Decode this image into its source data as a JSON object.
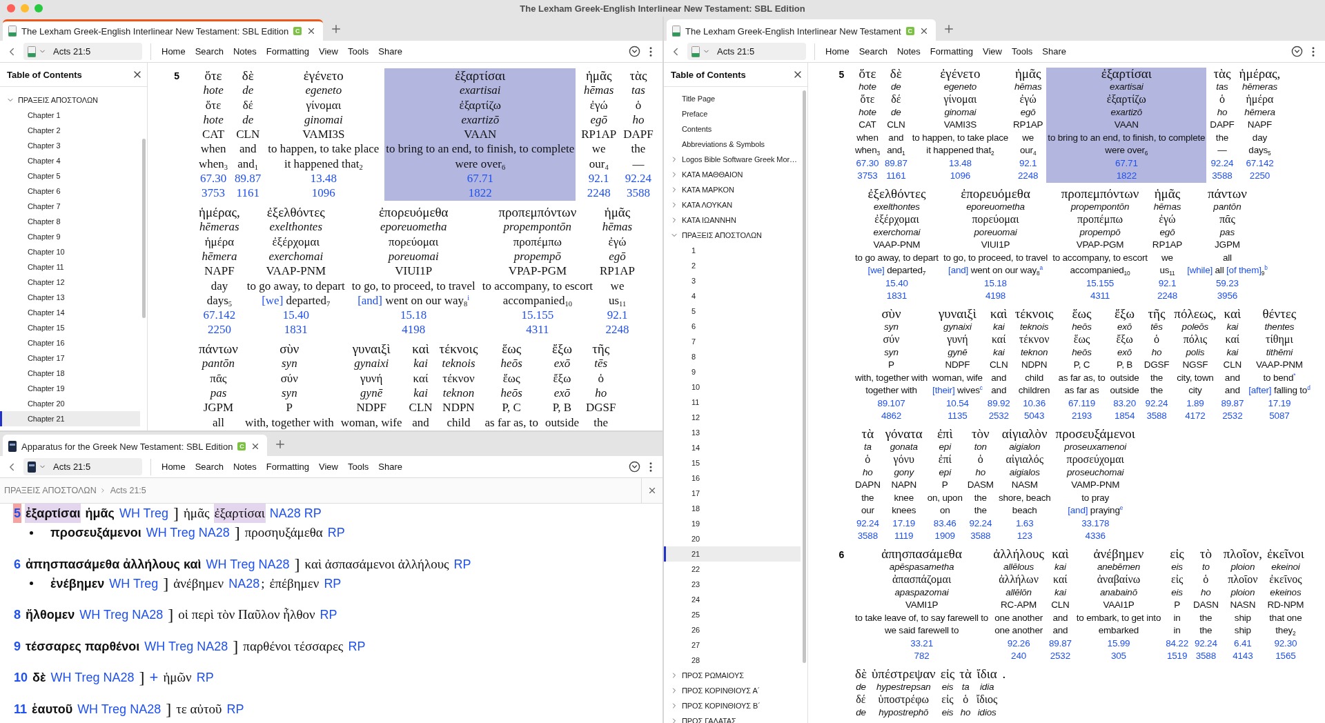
{
  "window": {
    "title": "The Lexham Greek-English Interlinear New Testament: SBL Edition"
  },
  "left_pane": {
    "tab": {
      "title": "The Lexham Greek-English Interlinear New Testament: SBL Edition",
      "badge": "C",
      "focused": true
    },
    "toolbar": {
      "reference": "Acts 21:5",
      "menu": [
        "Home",
        "Search",
        "Notes",
        "Formatting",
        "View",
        "Tools",
        "Share"
      ]
    },
    "toc": {
      "title": "Table of Contents",
      "items": [
        {
          "label": "ΠΡΑΞΕΙΣ ΑΠΟΣΤΟΛΩΝ",
          "expanded": true,
          "selected": false,
          "children": [
            {
              "label": "Chapter 1",
              "selected": false
            },
            {
              "label": "Chapter 2",
              "selected": false
            },
            {
              "label": "Chapter 3",
              "selected": false
            },
            {
              "label": "Chapter 4",
              "selected": false
            },
            {
              "label": "Chapter 5",
              "selected": false
            },
            {
              "label": "Chapter 6",
              "selected": false
            },
            {
              "label": "Chapter 7",
              "selected": false
            },
            {
              "label": "Chapter 8",
              "selected": false
            },
            {
              "label": "Chapter 9",
              "selected": false
            },
            {
              "label": "Chapter 10",
              "selected": false
            },
            {
              "label": "Chapter 11",
              "selected": false
            },
            {
              "label": "Chapter 12",
              "selected": false
            },
            {
              "label": "Chapter 13",
              "selected": false
            },
            {
              "label": "Chapter 14",
              "selected": false
            },
            {
              "label": "Chapter 15",
              "selected": false
            },
            {
              "label": "Chapter 16",
              "selected": false
            },
            {
              "label": "Chapter 17",
              "selected": false
            },
            {
              "label": "Chapter 18",
              "selected": false
            },
            {
              "label": "Chapter 19",
              "selected": false
            },
            {
              "label": "Chapter 20",
              "selected": false
            },
            {
              "label": "Chapter 21",
              "selected": true
            }
          ]
        }
      ]
    },
    "interlinear": {
      "verses": [
        {
          "number": "5",
          "rows": [
            {
              "words": [
                {
                  "greek": "ὅτε",
                  "translit": "hote",
                  "lemma": "ὅτε",
                  "lemma_translit": "hote",
                  "morph": "CAT",
                  "gloss": "when",
                  "translation": "when$_{3}$",
                  "louw_nida": "67.30",
                  "gk": "3753",
                  "selected": false
                },
                {
                  "greek": "δὲ",
                  "translit": "de",
                  "lemma": "δέ",
                  "lemma_translit": "de",
                  "morph": "CLN",
                  "gloss": "and",
                  "translation": "and$_{1}$",
                  "louw_nida": "89.87",
                  "gk": "1161",
                  "selected": false
                },
                {
                  "greek": "ἐγένετο",
                  "translit": "egeneto",
                  "lemma": "γίνομαι",
                  "lemma_translit": "ginomai",
                  "morph": "VAMI3S",
                  "gloss": "to happen, to take place",
                  "translation": "it happened that$_{2}$",
                  "louw_nida": "13.48",
                  "gk": "1096",
                  "selected": false
                },
                {
                  "greek": "ἐξαρτίσαι",
                  "translit": "exartisai",
                  "lemma": "ἐξαρτίζω",
                  "lemma_translit": "exartizō",
                  "morph": "VAAN",
                  "gloss": "to bring to an end, to finish, to complete",
                  "translation": "were over$_{6}$",
                  "louw_nida": "67.71",
                  "gk": "1822",
                  "selected": true
                },
                {
                  "greek": "ἡμᾶς",
                  "translit": "hēmas",
                  "lemma": "ἐγώ",
                  "lemma_translit": "egō",
                  "morph": "RP1AP",
                  "gloss": "we",
                  "translation": "our$_{4}$",
                  "louw_nida": "92.1",
                  "gk": "2248",
                  "selected": false
                },
                {
                  "greek": "τὰς",
                  "translit": "tas",
                  "lemma": "ὁ",
                  "lemma_translit": "ho",
                  "morph": "DAPF",
                  "gloss": "the",
                  "translation": "—",
                  "louw_nida": "92.24",
                  "gk": "3588",
                  "selected": false
                }
              ]
            },
            {
              "words": [
                {
                  "greek": "ἡμέρας,",
                  "translit": "hēmeras",
                  "lemma": "ἡμέρα",
                  "lemma_translit": "hēmera",
                  "morph": "NAPF",
                  "gloss": "day",
                  "translation": "days$_{5}$",
                  "louw_nida": "67.142",
                  "gk": "2250",
                  "selected": false
                },
                {
                  "greek": "ἐξελθόντες",
                  "translit": "exelthontes",
                  "lemma": "ἐξέρχομαι",
                  "lemma_translit": "exerchomai",
                  "morph": "VAAP-PNM",
                  "gloss": "to go away, to depart",
                  "translation": "[we] departed$_{7}$",
                  "louw_nida": "15.40",
                  "gk": "1831",
                  "selected": false
                },
                {
                  "greek": "ἐπορευόμεθα",
                  "translit": "eporeuometha",
                  "lemma": "πορεύομαι",
                  "lemma_translit": "poreuomai",
                  "morph": "VIUI1P",
                  "gloss": "to go, to proceed, to travel",
                  "translation": "[and] went on our way$_{8}$$^{i}$",
                  "louw_nida": "15.18",
                  "gk": "4198",
                  "selected": false
                },
                {
                  "greek": "προπεμπόντων",
                  "translit": "propempontōn",
                  "lemma": "προπέμπω",
                  "lemma_translit": "propempō",
                  "morph": "VPAP-PGM",
                  "gloss": "to accompany, to escort",
                  "translation": "accompanied$_{10}$",
                  "louw_nida": "15.155",
                  "gk": "4311",
                  "selected": false
                },
                {
                  "greek": "ἡμᾶς",
                  "translit": "hēmas",
                  "lemma": "ἐγώ",
                  "lemma_translit": "egō",
                  "morph": "RP1AP",
                  "gloss": "we",
                  "translation": "us$_{11}$",
                  "louw_nida": "92.1",
                  "gk": "2248",
                  "selected": false
                }
              ]
            },
            {
              "words": [
                {
                  "greek": "πάντων",
                  "translit": "pantōn",
                  "lemma": "πᾶς",
                  "lemma_translit": "pas",
                  "morph": "JGPM",
                  "gloss": "all",
                  "selected": false
                },
                {
                  "greek": "σὺν",
                  "translit": "syn",
                  "lemma": "σύν",
                  "lemma_translit": "syn",
                  "morph": "P",
                  "gloss": "with, together with",
                  "selected": false
                },
                {
                  "greek": "γυναιξὶ",
                  "translit": "gynaixi",
                  "lemma": "γυνή",
                  "lemma_translit": "gynē",
                  "morph": "NDPF",
                  "gloss": "woman, wife",
                  "selected": false
                },
                {
                  "greek": "καὶ",
                  "translit": "kai",
                  "lemma": "καί",
                  "lemma_translit": "kai",
                  "morph": "CLN",
                  "gloss": "and",
                  "selected": false
                },
                {
                  "greek": "τέκνοις",
                  "translit": "teknois",
                  "lemma": "τέκνον",
                  "lemma_translit": "teknon",
                  "morph": "NDPN",
                  "gloss": "child",
                  "selected": false
                },
                {
                  "greek": "ἕως",
                  "translit": "heōs",
                  "lemma": "ἕως",
                  "lemma_translit": "heōs",
                  "morph": "P, C",
                  "gloss": "as far as, to",
                  "selected": false
                },
                {
                  "greek": "ἔξω",
                  "translit": "exō",
                  "lemma": "ἔξω",
                  "lemma_translit": "exō",
                  "morph": "P, B",
                  "gloss": "outside",
                  "selected": false
                },
                {
                  "greek": "τῆς",
                  "translit": "tēs",
                  "lemma": "ὁ",
                  "lemma_translit": "ho",
                  "morph": "DGSF",
                  "gloss": "the",
                  "selected": false
                }
              ]
            }
          ]
        }
      ]
    }
  },
  "apparatus_pane": {
    "tab": {
      "title": "Apparatus for the Greek New Testament: SBL Edition",
      "badge": "C",
      "focused": false
    },
    "toolbar": {
      "reference": "Acts 21:5",
      "menu": [
        "Home",
        "Search",
        "Notes",
        "Formatting",
        "View",
        "Tools",
        "Share"
      ]
    },
    "breadcrumb": [
      "ΠΡΑΞΕΙΣ ΑΠΟΣΤΟΛΩΝ",
      "Acts 21:5"
    ],
    "entries": [
      {
        "kind": "main",
        "segments": [
          {
            "kind": "verse",
            "text": "5",
            "highlighted": true
          },
          {
            "kind": "lemma",
            "text": "ἐξαρτίσαι",
            "highlighted": true
          },
          {
            "kind": "lemma",
            "text": "ἡμᾶς",
            "highlighted": false
          },
          {
            "kind": "siglum",
            "text": "WH Treg",
            "highlighted": false
          },
          {
            "kind": "bracket",
            "text": "]",
            "highlighted": false
          },
          {
            "kind": "reading",
            "text": "ἡμᾶς",
            "highlighted": false
          },
          {
            "kind": "reading",
            "text": "ἐξαρτίσαι",
            "highlighted": true
          },
          {
            "kind": "siglum",
            "text": "NA28 RP",
            "highlighted": false
          }
        ]
      },
      {
        "kind": "sub",
        "segments": [
          {
            "kind": "lemma",
            "text": "προσευξάμενοι",
            "highlighted": false
          },
          {
            "kind": "siglum",
            "text": "WH Treg NA28",
            "highlighted": false
          },
          {
            "kind": "bracket",
            "text": "]",
            "highlighted": false
          },
          {
            "kind": "reading",
            "text": "προσηυξάμεθα",
            "highlighted": false
          },
          {
            "kind": "siglum",
            "text": "RP",
            "highlighted": false
          }
        ]
      },
      {
        "kind": "main",
        "segments": [
          {
            "kind": "verse",
            "text": "6",
            "highlighted": false
          },
          {
            "kind": "lemma",
            "text": "ἀπησπασάμεθα ἀλλήλους καὶ",
            "highlighted": false
          },
          {
            "kind": "siglum",
            "text": "WH Treg NA28",
            "highlighted": false
          },
          {
            "kind": "bracket",
            "text": "]",
            "highlighted": false
          },
          {
            "kind": "reading",
            "text": "καὶ ἀσπασάμενοι ἀλλήλους",
            "highlighted": false
          },
          {
            "kind": "siglum",
            "text": "RP",
            "highlighted": false
          }
        ]
      },
      {
        "kind": "sub",
        "segments": [
          {
            "kind": "lemma",
            "text": "ἐνέβημεν",
            "highlighted": false
          },
          {
            "kind": "siglum",
            "text": "WH Treg",
            "highlighted": false
          },
          {
            "kind": "bracket",
            "text": "]",
            "highlighted": false
          },
          {
            "kind": "reading",
            "text": "ἀνέβημεν",
            "highlighted": false
          },
          {
            "kind": "siglum",
            "text": "NA28",
            "highlighted": false
          },
          {
            "kind": "punct",
            "text": ";",
            "highlighted": false
          },
          {
            "kind": "reading",
            "text": "ἐπέβημεν",
            "highlighted": false
          },
          {
            "kind": "siglum",
            "text": "RP",
            "highlighted": false
          }
        ]
      },
      {
        "kind": "main",
        "segments": [
          {
            "kind": "verse",
            "text": "8",
            "highlighted": false
          },
          {
            "kind": "lemma",
            "text": "ἤλθομεν",
            "highlighted": false
          },
          {
            "kind": "siglum",
            "text": "WH Treg NA28",
            "highlighted": false
          },
          {
            "kind": "bracket",
            "text": "]",
            "highlighted": false
          },
          {
            "kind": "reading",
            "text": "οἱ περὶ τὸν Παῦλον ἦλθον",
            "highlighted": false
          },
          {
            "kind": "siglum",
            "text": "RP",
            "highlighted": false
          }
        ]
      },
      {
        "kind": "main",
        "segments": [
          {
            "kind": "verse",
            "text": "9",
            "highlighted": false
          },
          {
            "kind": "lemma",
            "text": "τέσσαρες παρθένοι",
            "highlighted": false
          },
          {
            "kind": "siglum",
            "text": "WH Treg NA28",
            "highlighted": false
          },
          {
            "kind": "bracket",
            "text": "]",
            "highlighted": false
          },
          {
            "kind": "reading",
            "text": "παρθένοι τέσσαρες",
            "highlighted": false
          },
          {
            "kind": "siglum",
            "text": "RP",
            "highlighted": false
          }
        ]
      },
      {
        "kind": "main",
        "segments": [
          {
            "kind": "verse",
            "text": "10",
            "highlighted": false
          },
          {
            "kind": "lemma",
            "text": "δὲ",
            "highlighted": false
          },
          {
            "kind": "siglum",
            "text": "WH Treg NA28",
            "highlighted": false
          },
          {
            "kind": "bracket",
            "text": "]",
            "highlighted": false
          },
          {
            "kind": "sign",
            "text": "+",
            "highlighted": false
          },
          {
            "kind": "reading",
            "text": "ἡμῶν",
            "highlighted": false
          },
          {
            "kind": "siglum",
            "text": "RP",
            "highlighted": false
          }
        ]
      },
      {
        "kind": "main",
        "segments": [
          {
            "kind": "verse",
            "text": "11",
            "highlighted": false
          },
          {
            "kind": "lemma",
            "text": "ἑαυτοῦ",
            "highlighted": false
          },
          {
            "kind": "siglum",
            "text": "WH Treg NA28",
            "highlighted": false
          },
          {
            "kind": "bracket",
            "text": "]",
            "highlighted": false
          },
          {
            "kind": "reading",
            "text": "τε αὐτοῦ",
            "highlighted": false
          },
          {
            "kind": "siglum",
            "text": "RP",
            "highlighted": false
          }
        ]
      }
    ]
  },
  "right_pane": {
    "tab": {
      "title": "The Lexham Greek-English Interlinear New Testament",
      "badge": "C",
      "focused": false
    },
    "toolbar": {
      "reference": "Acts 21:5",
      "menu": [
        "Home",
        "Search",
        "Notes",
        "Formatting",
        "View",
        "Tools",
        "Share"
      ]
    },
    "toc": {
      "title": "Table of Contents",
      "items": [
        {
          "label": "Title Page",
          "selected": false
        },
        {
          "label": "Preface",
          "selected": false
        },
        {
          "label": "Contents",
          "selected": false
        },
        {
          "label": "Abbreviations & Symbols",
          "selected": false
        },
        {
          "label": "Logos Bible Software Greek Mor…",
          "expanded": false,
          "selected": false
        },
        {
          "label": "ΚΑΤΑ ΜΑΘΘΑΙΟΝ",
          "expanded": false,
          "selected": false
        },
        {
          "label": "ΚΑΤΑ ΜΑΡΚΟΝ",
          "expanded": false,
          "selected": false
        },
        {
          "label": "ΚΑΤΑ ΛΟΥΚΑΝ",
          "expanded": false,
          "selected": false
        },
        {
          "label": "ΚΑΤΑ ΙΩΑΝΝΗΝ",
          "expanded": false,
          "selected": false
        },
        {
          "label": "ΠΡΑΞΕΙΣ ΑΠΟΣΤΟΛΩΝ",
          "expanded": true,
          "selected": false,
          "children": [
            {
              "label": "1",
              "selected": false
            },
            {
              "label": "2",
              "selected": false
            },
            {
              "label": "3",
              "selected": false
            },
            {
              "label": "4",
              "selected": false
            },
            {
              "label": "5",
              "selected": false
            },
            {
              "label": "6",
              "selected": false
            },
            {
              "label": "7",
              "selected": false
            },
            {
              "label": "8",
              "selected": false
            },
            {
              "label": "9",
              "selected": false
            },
            {
              "label": "10",
              "selected": false
            },
            {
              "label": "11",
              "selected": false
            },
            {
              "label": "12",
              "selected": false
            },
            {
              "label": "13",
              "selected": false
            },
            {
              "label": "14",
              "selected": false
            },
            {
              "label": "15",
              "selected": false
            },
            {
              "label": "16",
              "selected": false
            },
            {
              "label": "17",
              "selected": false
            },
            {
              "label": "18",
              "selected": false
            },
            {
              "label": "19",
              "selected": false
            },
            {
              "label": "20",
              "selected": false
            },
            {
              "label": "21",
              "selected": true
            },
            {
              "label": "22",
              "selected": false
            },
            {
              "label": "23",
              "selected": false
            },
            {
              "label": "24",
              "selected": false
            },
            {
              "label": "25",
              "selected": false
            },
            {
              "label": "26",
              "selected": false
            },
            {
              "label": "27",
              "selected": false
            },
            {
              "label": "28",
              "selected": false
            }
          ]
        },
        {
          "label": "ΠΡΟΣ ΡΩΜΑΙΟΥΣ",
          "expanded": false,
          "selected": false
        },
        {
          "label": "ΠΡΟΣ ΚΟΡΙΝΘΙΟΥΣ Α´",
          "expanded": false,
          "selected": false
        },
        {
          "label": "ΠΡΟΣ ΚΟΡΙΝΘΙΟΥΣ Β´",
          "expanded": false,
          "selected": false
        },
        {
          "label": "ΠΡΟΣ ΓΑΛΑΤΑΣ",
          "expanded": false,
          "selected": false
        }
      ]
    },
    "interlinear": {
      "verses": [
        {
          "number": "5",
          "rows": [
            {
              "words": [
                {
                  "greek": "ὅτε",
                  "translit": "hote",
                  "lemma": "ὅτε",
                  "lemma_translit": "hote",
                  "morph": "CAT",
                  "gloss": "when",
                  "translation": "when$_{3}$",
                  "louw_nida": "67.30",
                  "gk": "3753",
                  "selected": false
                },
                {
                  "greek": "δὲ",
                  "translit": "de",
                  "lemma": "δέ",
                  "lemma_translit": "de",
                  "morph": "CLN",
                  "gloss": "and",
                  "translation": "and$_{1}$",
                  "louw_nida": "89.87",
                  "gk": "1161",
                  "selected": false
                },
                {
                  "greek": "ἐγένετο",
                  "translit": "egeneto",
                  "lemma": "γίνομαι",
                  "lemma_translit": "ginomai",
                  "morph": "VAMI3S",
                  "gloss": "to happen, to take place",
                  "translation": "it happened that$_{2}$",
                  "louw_nida": "13.48",
                  "gk": "1096",
                  "selected": false
                },
                {
                  "greek": "ἡμᾶς",
                  "translit": "hēmas",
                  "lemma": "ἐγώ",
                  "lemma_translit": "egō",
                  "morph": "RP1AP",
                  "gloss": "we",
                  "translation": "our$_{4}$",
                  "louw_nida": "92.1",
                  "gk": "2248",
                  "selected": false
                },
                {
                  "greek": "ἐξαρτίσαι",
                  "translit": "exartisai",
                  "lemma": "ἐξαρτίζω",
                  "lemma_translit": "exartizō",
                  "morph": "VAAN",
                  "gloss": "to bring to an end, to finish, to complete",
                  "translation": "were over$_{6}$",
                  "louw_nida": "67.71",
                  "gk": "1822",
                  "selected": true
                },
                {
                  "greek": "τὰς",
                  "translit": "tas",
                  "lemma": "ὁ",
                  "lemma_translit": "ho",
                  "morph": "DAPF",
                  "gloss": "the",
                  "translation": "—",
                  "louw_nida": "92.24",
                  "gk": "3588",
                  "selected": false
                },
                {
                  "greek": "ἡμέρας,",
                  "translit": "hēmeras",
                  "lemma": "ἡμέρα",
                  "lemma_translit": "hēmera",
                  "morph": "NAPF",
                  "gloss": "day",
                  "translation": "days$_{5}$",
                  "louw_nida": "67.142",
                  "gk": "2250",
                  "selected": false
                }
              ]
            },
            {
              "words": [
                {
                  "greek": "ἐξελθόντες",
                  "translit": "exelthontes",
                  "lemma": "ἐξέρχομαι",
                  "lemma_translit": "exerchomai",
                  "morph": "VAAP-PNM",
                  "gloss": "to go away, to depart",
                  "translation": "[we] departed$_{7}$",
                  "louw_nida": "15.40",
                  "gk": "1831",
                  "selected": false
                },
                {
                  "greek": "ἐπορευόμεθα",
                  "translit": "eporeuometha",
                  "lemma": "πορεύομαι",
                  "lemma_translit": "poreuomai",
                  "morph": "VIUI1P",
                  "gloss": "to go, to proceed, to travel",
                  "translation": "[and] went on our way$_{8}$$^{a}$",
                  "louw_nida": "15.18",
                  "gk": "4198",
                  "selected": false
                },
                {
                  "greek": "προπεμπόντων",
                  "translit": "propempontōn",
                  "lemma": "προπέμπω",
                  "lemma_translit": "propempō",
                  "morph": "VPAP-PGM",
                  "gloss": "to accompany, to escort",
                  "translation": "accompanied$_{10}$",
                  "louw_nida": "15.155",
                  "gk": "4311",
                  "selected": false
                },
                {
                  "greek": "ἡμᾶς",
                  "translit": "hēmas",
                  "lemma": "ἐγώ",
                  "lemma_translit": "egō",
                  "morph": "RP1AP",
                  "gloss": "we",
                  "translation": "us$_{11}$",
                  "louw_nida": "92.1",
                  "gk": "2248",
                  "selected": false
                },
                {
                  "greek": "πάντων",
                  "translit": "pantōn",
                  "lemma": "πᾶς",
                  "lemma_translit": "pas",
                  "morph": "JGPM",
                  "gloss": "all",
                  "translation": "[while] all [of them]$_{9}$$^{b}$",
                  "louw_nida": "59.23",
                  "gk": "3956",
                  "selected": false
                }
              ]
            },
            {
              "words": [
                {
                  "greek": "σὺν",
                  "translit": "syn",
                  "lemma": "σύν",
                  "lemma_translit": "syn",
                  "morph": "P",
                  "gloss": "with, together with",
                  "translation": "together with",
                  "louw_nida": "89.107",
                  "gk": "4862",
                  "selected": false
                },
                {
                  "greek": "γυναιξὶ",
                  "translit": "gynaixi",
                  "lemma": "γυνή",
                  "lemma_translit": "gynē",
                  "morph": "NDPF",
                  "gloss": "woman, wife",
                  "translation": "[their] wives$^{c}$",
                  "louw_nida": "10.54",
                  "gk": "1135",
                  "selected": false
                },
                {
                  "greek": "καὶ",
                  "translit": "kai",
                  "lemma": "καί",
                  "lemma_translit": "kai",
                  "morph": "CLN",
                  "gloss": "and",
                  "translation": "and",
                  "louw_nida": "89.92",
                  "gk": "2532",
                  "selected": false
                },
                {
                  "greek": "τέκνοις",
                  "translit": "teknois",
                  "lemma": "τέκνον",
                  "lemma_translit": "teknon",
                  "morph": "NDPN",
                  "gloss": "child",
                  "translation": "children",
                  "louw_nida": "10.36",
                  "gk": "5043",
                  "selected": false
                },
                {
                  "greek": "ἕως",
                  "translit": "heōs",
                  "lemma": "ἕως",
                  "lemma_translit": "heōs",
                  "morph": "P, C",
                  "gloss": "as far as, to",
                  "translation": "as far as",
                  "louw_nida": "67.119",
                  "gk": "2193",
                  "selected": false
                },
                {
                  "greek": "ἔξω",
                  "translit": "exō",
                  "lemma": "ἔξω",
                  "lemma_translit": "exō",
                  "morph": "P, B",
                  "gloss": "outside",
                  "translation": "outside",
                  "louw_nida": "83.20",
                  "gk": "1854",
                  "selected": false
                },
                {
                  "greek": "τῆς",
                  "translit": "tēs",
                  "lemma": "ὁ",
                  "lemma_translit": "ho",
                  "morph": "DGSF",
                  "gloss": "the",
                  "translation": "the",
                  "louw_nida": "92.24",
                  "gk": "3588",
                  "selected": false
                },
                {
                  "greek": "πόλεως,",
                  "translit": "poleōs",
                  "lemma": "πόλις",
                  "lemma_translit": "polis",
                  "morph": "NGSF",
                  "gloss": "city, town",
                  "translation": "city",
                  "louw_nida": "1.89",
                  "gk": "4172",
                  "selected": false
                },
                {
                  "greek": "καὶ",
                  "translit": "kai",
                  "lemma": "καί",
                  "lemma_translit": "kai",
                  "morph": "CLN",
                  "gloss": "and",
                  "translation": "and",
                  "louw_nida": "89.87",
                  "gk": "2532",
                  "selected": false
                },
                {
                  "greek": "θέντες",
                  "translit": "thentes",
                  "lemma": "τίθημι",
                  "lemma_translit": "tithēmi",
                  "morph": "VAAP-PNM",
                  "gloss": "to bend$^{*}$",
                  "translation": "[after] falling to$^{d}$",
                  "louw_nida": "17.19",
                  "gk": "5087",
                  "selected": false
                }
              ]
            },
            {
              "words": [
                {
                  "greek": "τὰ",
                  "translit": "ta",
                  "lemma": "ὁ",
                  "lemma_translit": "ho",
                  "morph": "DAPN",
                  "gloss": "the",
                  "translation": "our",
                  "louw_nida": "92.24",
                  "gk": "3588",
                  "selected": false
                },
                {
                  "greek": "γόνατα",
                  "translit": "gonata",
                  "lemma": "γόνυ",
                  "lemma_translit": "gony",
                  "morph": "NAPN",
                  "gloss": "knee",
                  "translation": "knees",
                  "louw_nida": "17.19",
                  "gk": "1119",
                  "selected": false
                },
                {
                  "greek": "ἐπὶ",
                  "translit": "epi",
                  "lemma": "ἐπί",
                  "lemma_translit": "epi",
                  "morph": "P",
                  "gloss": "on, upon",
                  "translation": "on",
                  "louw_nida": "83.46",
                  "gk": "1909",
                  "selected": false
                },
                {
                  "greek": "τὸν",
                  "translit": "ton",
                  "lemma": "ὁ",
                  "lemma_translit": "ho",
                  "morph": "DASM",
                  "gloss": "the",
                  "translation": "the",
                  "louw_nida": "92.24",
                  "gk": "3588",
                  "selected": false
                },
                {
                  "greek": "αἰγιαλὸν",
                  "translit": "aigialon",
                  "lemma": "αἰγιαλός",
                  "lemma_translit": "aigialos",
                  "morph": "NASM",
                  "gloss": "shore, beach",
                  "translation": "beach",
                  "louw_nida": "1.63",
                  "gk": "123",
                  "selected": false
                },
                {
                  "greek": "προσευξάμενοι",
                  "translit": "proseuxamenoi",
                  "lemma": "προσεύχομαι",
                  "lemma_translit": "proseuchomai",
                  "morph": "VAMP-PNM",
                  "gloss": "to pray",
                  "translation": "[and] praying$^{e}$",
                  "louw_nida": "33.178",
                  "gk": "4336",
                  "selected": false
                }
              ]
            }
          ]
        },
        {
          "number": "6",
          "rows": [
            {
              "words": [
                {
                  "greek": "ἀπησπασάμεθα",
                  "translit": "apēspasametha",
                  "lemma": "ἀπασπάζομαι",
                  "lemma_translit": "apaspazomai",
                  "morph": "VAMI1P",
                  "gloss": "to take leave of, to say farewell to",
                  "translation": "we said farewell to",
                  "louw_nida": "33.21",
                  "gk": "782",
                  "selected": false
                },
                {
                  "greek": "ἀλλήλους",
                  "translit": "allēlous",
                  "lemma": "ἀλλήλων",
                  "lemma_translit": "allēlōn",
                  "morph": "RC-APM",
                  "gloss": "one another",
                  "translation": "one another",
                  "louw_nida": "92.26",
                  "gk": "240",
                  "selected": false
                },
                {
                  "greek": "καὶ",
                  "translit": "kai",
                  "lemma": "καί",
                  "lemma_translit": "kai",
                  "morph": "CLN",
                  "gloss": "and",
                  "translation": "and",
                  "louw_nida": "89.87",
                  "gk": "2532",
                  "selected": false
                },
                {
                  "greek": "ἀνέβημεν",
                  "translit": "anebēmen",
                  "lemma": "ἀναβαίνω",
                  "lemma_translit": "anabainō",
                  "morph": "VAAI1P",
                  "gloss": "to embark, to get into",
                  "translation": "embarked",
                  "louw_nida": "15.99",
                  "gk": "305",
                  "selected": false
                },
                {
                  "greek": "εἰς",
                  "translit": "eis",
                  "lemma": "εἰς",
                  "lemma_translit": "eis",
                  "morph": "P",
                  "gloss": "in",
                  "translation": "in",
                  "louw_nida": "84.22",
                  "gk": "1519",
                  "selected": false
                },
                {
                  "greek": "τὸ",
                  "translit": "to",
                  "lemma": "ὁ",
                  "lemma_translit": "ho",
                  "morph": "DASN",
                  "gloss": "the",
                  "translation": "the",
                  "louw_nida": "92.24",
                  "gk": "3588",
                  "selected": false
                },
                {
                  "greek": "πλοῖον,",
                  "translit": "ploion",
                  "lemma": "πλοῖον",
                  "lemma_translit": "ploion",
                  "morph": "NASN",
                  "gloss": "ship",
                  "translation": "ship",
                  "louw_nida": "6.41",
                  "gk": "4143",
                  "selected": false
                },
                {
                  "greek": "ἐκεῖνοι",
                  "translit": "ekeinoi",
                  "lemma": "ἐκεῖνος",
                  "lemma_translit": "ekeinos",
                  "morph": "RD-NPM",
                  "gloss": "that one",
                  "translation": "they$_{2}$",
                  "louw_nida": "92.30",
                  "gk": "1565",
                  "selected": false
                }
              ]
            },
            {
              "words": [
                {
                  "greek": "δὲ",
                  "translit": "de",
                  "lemma": "δέ",
                  "lemma_translit": "de",
                  "selected": false
                },
                {
                  "greek": "ὑπέστρεψαν",
                  "translit": "hypestrepsan",
                  "lemma": "ὑποστρέφω",
                  "lemma_translit": "hypostrephō",
                  "selected": false
                },
                {
                  "greek": "εἰς",
                  "translit": "eis",
                  "lemma": "εἰς",
                  "lemma_translit": "eis",
                  "selected": false
                },
                {
                  "greek": "τὰ",
                  "translit": "ta",
                  "lemma": "ὁ",
                  "lemma_translit": "ho",
                  "selected": false
                },
                {
                  "greek": "ἴδια",
                  "translit": "idia",
                  "lemma": "ἴδιος",
                  "lemma_translit": "idios",
                  "selected": false
                },
                {
                  "greek": ".",
                  "selected": false
                }
              ]
            }
          ]
        }
      ]
    }
  }
}
